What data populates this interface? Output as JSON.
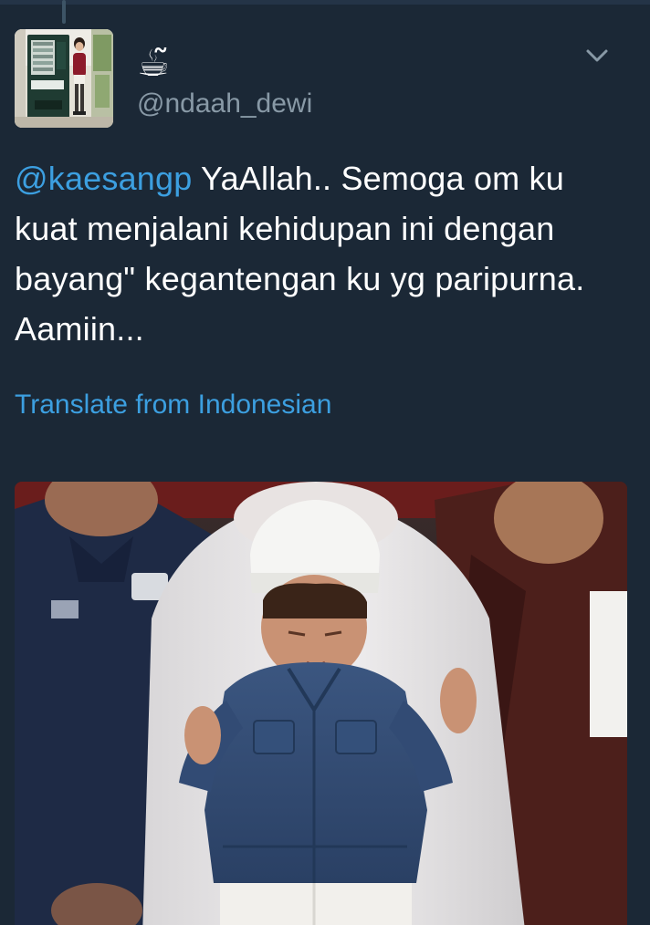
{
  "tweet": {
    "display_name": "☕̃",
    "handle": "@ndaah_dewi",
    "mention": "@kaesangp",
    "text": " YaAllah.. Semoga om ku kuat menjalani kehidupan ini dengan bayang\" kegantengan ku yg paripurna. Aamiin...",
    "translate_label": "Translate from Indonesian"
  },
  "icons": {
    "menu": "chevron-down-icon"
  },
  "colors": {
    "background": "#1b2836",
    "link": "#3c9fe0",
    "secondary_text": "#8899a6"
  }
}
